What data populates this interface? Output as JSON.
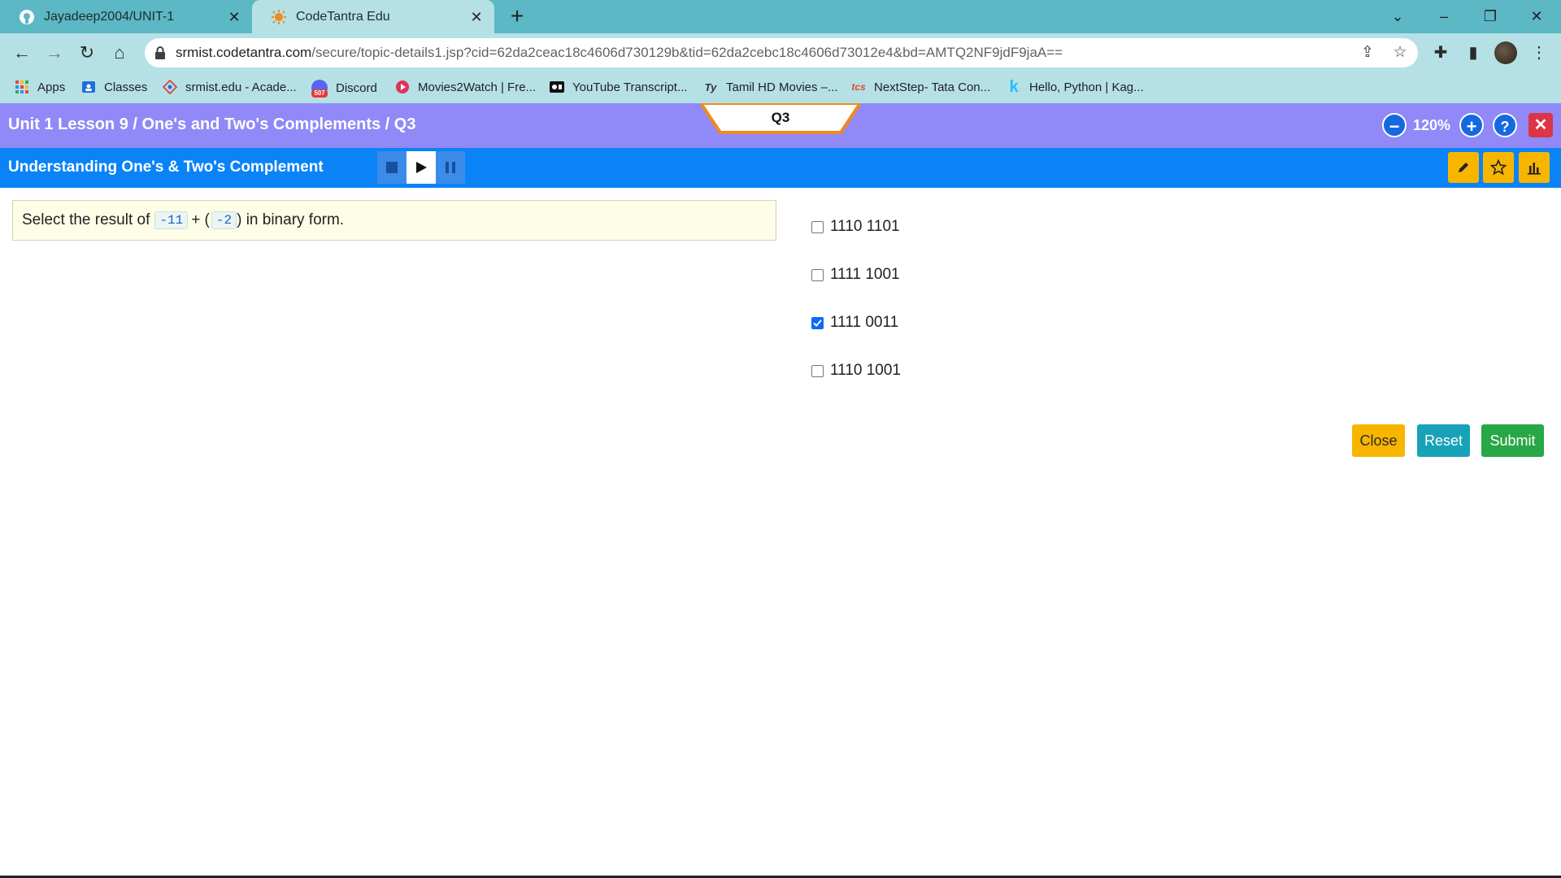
{
  "browser": {
    "tabs": [
      {
        "title": "Jayadeep2004/UNIT-1",
        "icon": "github-icon"
      },
      {
        "title": "CodeTantra Edu",
        "icon": "codetantra-icon"
      }
    ],
    "url_host": "srmist.codetantra.com",
    "url_rest": "/secure/topic-details1.jsp?cid=62da2ceac18c4606d730129b&tid=62da2cebc18c4606d73012e4&bd=AMTQ2NF9jdF9jaA==",
    "bookmarks": [
      {
        "label": "Apps",
        "icon": "apps-grid-icon"
      },
      {
        "label": "Classes",
        "icon": "classes-icon"
      },
      {
        "label": "srmist.edu - Acade...",
        "icon": "srmist-icon"
      },
      {
        "label": "Discord",
        "icon": "discord-icon"
      },
      {
        "label": "Movies2Watch | Fre...",
        "icon": "movies2watch-icon"
      },
      {
        "label": "YouTube Transcript...",
        "icon": "youtube-transcript-icon"
      },
      {
        "label": "Tamil HD Movies –...",
        "icon": "tamil-movies-icon"
      },
      {
        "label": "NextStep- Tata Con...",
        "icon": "tcs-icon"
      },
      {
        "label": "Hello, Python | Kag...",
        "icon": "kaggle-icon"
      }
    ],
    "bookmark_glyphs": {
      "discord": "507",
      "tamil": "Ty",
      "tcs": "tcs",
      "kaggle": "k"
    }
  },
  "header": {
    "lesson_title": "Unit 1 Lesson 9 / One's and Two's Complements / Q3",
    "question_tab": "Q3",
    "zoom": "120%",
    "sub_title": "Understanding One's & Two's Complement"
  },
  "question": {
    "prefix": "Select the result of",
    "operand1": "-11",
    "operator": "+ (",
    "operand2": "-2",
    "suffix": ") in binary form."
  },
  "options": [
    {
      "label": "1110 1101",
      "checked": false
    },
    {
      "label": "1111 1001",
      "checked": false
    },
    {
      "label": "1111 0011",
      "checked": true
    },
    {
      "label": "1110 1001",
      "checked": false
    }
  ],
  "actions": {
    "close": "Close",
    "reset": "Reset",
    "submit": "Submit"
  },
  "colors": {
    "tabbar": "#5bb8c4",
    "topbar": "#9089f7",
    "subbar": "#0a83f7",
    "close_btn": "#f7b500",
    "reset_btn": "#17a2b8",
    "submit_btn": "#28a745"
  }
}
